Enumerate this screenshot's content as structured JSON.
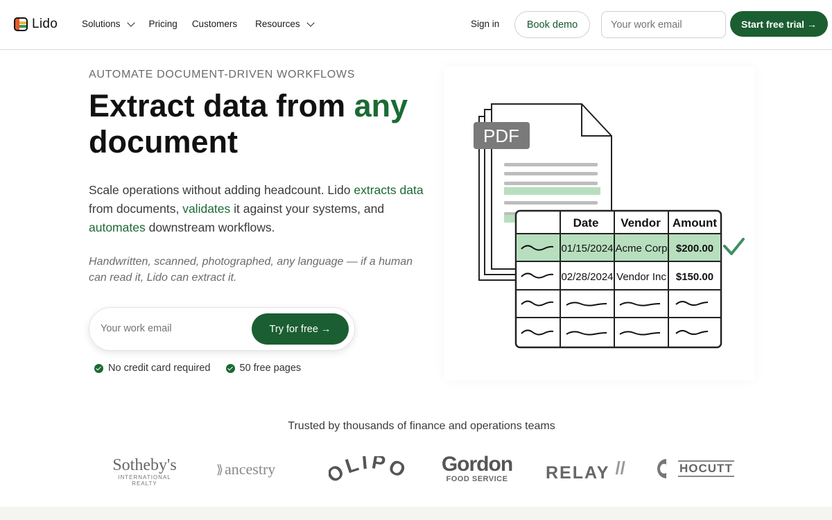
{
  "nav": {
    "logo_text": "Lido",
    "links": [
      {
        "label": "Solutions",
        "dropdown": true
      },
      {
        "label": "Pricing",
        "dropdown": false
      },
      {
        "label": "Customers",
        "dropdown": false
      },
      {
        "label": "Resources",
        "dropdown": true
      }
    ],
    "sign_in": "Sign in",
    "book_demo": "Book demo",
    "email_placeholder": "Your work email",
    "start_trial": "Start free trial →"
  },
  "hero": {
    "eyebrow": "AUTOMATE DOCUMENT-DRIVEN WORKFLOWS",
    "headline_part1": "Extract data from ",
    "headline_accent": "any",
    "headline_part2": "document",
    "sub": {
      "t1": "Scale operations without adding headcount. Lido ",
      "g1": "extracts data",
      "t2": " from documents, ",
      "g2": "validates",
      "t3": " it against your systems, and ",
      "g3": "automates",
      "t4": " downstream workflows."
    },
    "note": "Handwritten, scanned, photographed, any language — if a human can read it, Lido can extract it.",
    "cta_placeholder": "Your work email",
    "cta_button": "Try for free →",
    "checks": [
      "No credit card required",
      "50 free pages"
    ]
  },
  "illustration": {
    "badge": "PDF",
    "table_headers": [
      "Date",
      "Vendor",
      "Amount"
    ],
    "rows": [
      {
        "date": "01/15/2024",
        "vendor": "Acme Corp",
        "amount": "$200.00",
        "highlighted": true
      },
      {
        "date": "02/28/2024",
        "vendor": "Vendor Inc",
        "amount": "$150.00",
        "highlighted": false
      }
    ],
    "accent_color": "#b7dfbe",
    "check_color": "#3f8f62"
  },
  "trusted": {
    "heading": "Trusted by thousands of finance and operations teams",
    "logos": [
      {
        "name": "Sotheby's",
        "line1": "Sotheby's",
        "line2": "INTERNATIONAL REALTY"
      },
      {
        "name": "ancestry",
        "line1": "ancestry"
      },
      {
        "name": "OLIPOP",
        "line1": "OLIPOP"
      },
      {
        "name": "Gordon",
        "line1": "Gordon",
        "line2": "FOOD SERVICE"
      },
      {
        "name": "RELAY",
        "line1": "RELAY"
      },
      {
        "name": "HOCUTT",
        "line1": "HOCUTT"
      }
    ]
  },
  "colors": {
    "brand_green": "#1b5e32",
    "accent_green": "#1b6a33"
  }
}
